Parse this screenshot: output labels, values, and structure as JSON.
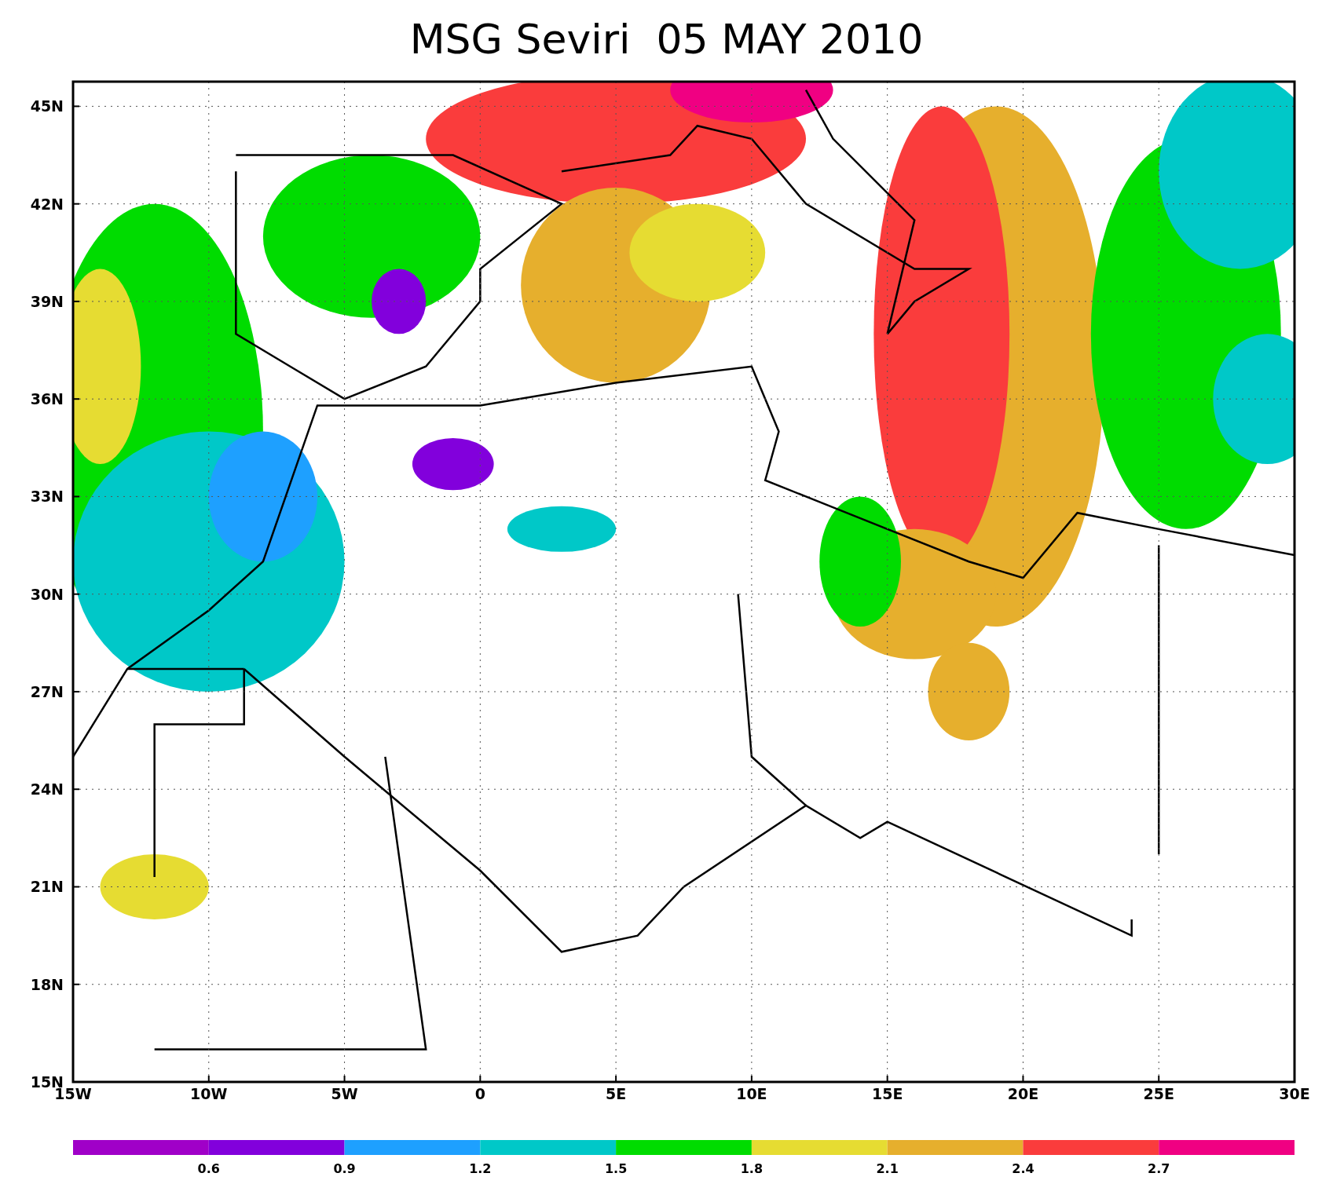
{
  "title": "MSG Seviri  05 MAY 2010",
  "map": {
    "x_ticks": [
      "15W",
      "10W",
      "5W",
      "0",
      "5E",
      "10E",
      "15E",
      "20E",
      "25E",
      "30E"
    ],
    "y_ticks": [
      "45N",
      "42N",
      "39N",
      "36N",
      "33N",
      "30N",
      "27N",
      "24N",
      "21N",
      "18N",
      "15N"
    ]
  },
  "colorbar": {
    "segments": [
      {
        "color": "#a000c8"
      },
      {
        "color": "#8200dc"
      },
      {
        "color": "#1ea0ff"
      },
      {
        "color": "#00c8c8"
      },
      {
        "color": "#00dc00"
      },
      {
        "color": "#e6dc32"
      },
      {
        "color": "#e6af2d"
      },
      {
        "color": "#fa3c3c"
      },
      {
        "color": "#f00082"
      }
    ],
    "labels": [
      "0.6",
      "0.9",
      "1.2",
      "1.5",
      "1.8",
      "2.1",
      "2.4",
      "2.7"
    ]
  }
}
